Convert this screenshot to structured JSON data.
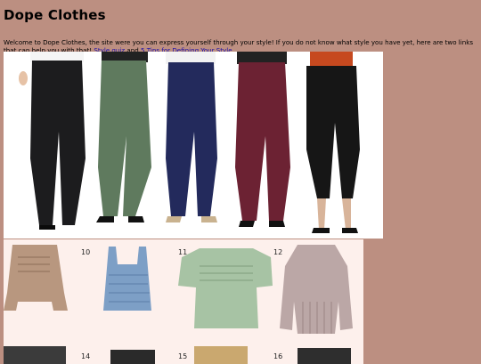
{
  "page": {
    "title": "Dope Clothes",
    "intro_text": "Welcome to Dope Clothes, the site were you can express yourself through your style! If you do not know what style you have yet, here are two links that can help you with that!",
    "link_connector": "and",
    "links": [
      {
        "label": "Style quiz"
      },
      {
        "label": "5 Tips for Defining Your Style"
      }
    ]
  },
  "images": {
    "pants": {
      "items": [
        {
          "name": "black-trousers",
          "color": "#1c1c1e"
        },
        {
          "name": "green-trousers",
          "color": "#5f7a5e"
        },
        {
          "name": "navy-trousers",
          "color": "#232a5c"
        },
        {
          "name": "burgundy-trousers",
          "color": "#6c2233"
        },
        {
          "name": "black-tapered-trousers",
          "color": "#161616"
        }
      ]
    },
    "tops": {
      "numbers": [
        "10",
        "11",
        "12",
        "14",
        "15",
        "16"
      ],
      "items": [
        {
          "name": "floral-smocked-top",
          "color": "#b8977f"
        },
        {
          "name": "blue-plaid-peplum-top",
          "color": "#7d9fc6"
        },
        {
          "name": "green-smocked-top",
          "color": "#a7c3a4"
        },
        {
          "name": "mauve-pleated-blouse",
          "color": "#bba7a6"
        }
      ]
    }
  }
}
